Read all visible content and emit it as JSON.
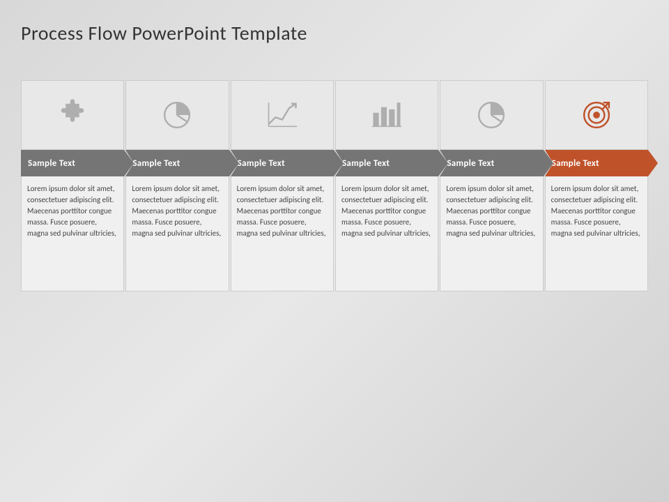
{
  "title": "Process Flow PowerPoint Template",
  "steps": [
    {
      "id": 1,
      "label": "Sample Text",
      "icon": "puzzle",
      "isLast": false,
      "isFirst": true,
      "body": "Lorem ipsum dolor sit amet, consectetuer adipiscing elit. Maecenas porttitor congue massa. Fusce posuere, magna sed pulvinar ultricies,"
    },
    {
      "id": 2,
      "label": "Sample Text",
      "icon": "pie",
      "isLast": false,
      "isFirst": false,
      "body": "Lorem ipsum dolor sit amet, consectetuer adipiscing elit. Maecenas porttitor congue massa. Fusce posuere, magna sed pulvinar ultricies,"
    },
    {
      "id": 3,
      "label": "Sample Text",
      "icon": "linechart",
      "isLast": false,
      "isFirst": false,
      "body": "Lorem ipsum dolor sit amet, consectetuer adipiscing elit. Maecenas porttitor congue massa. Fusce posuere, magna sed pulvinar ultricies,"
    },
    {
      "id": 4,
      "label": "Sample Text",
      "icon": "barchart",
      "isLast": false,
      "isFirst": false,
      "body": "Lorem ipsum dolor sit amet, consectetuer adipiscing elit. Maecenas porttitor congue massa. Fusce posuere, magna sed pulvinar ultricies,"
    },
    {
      "id": 5,
      "label": "Sample Text",
      "icon": "pie2",
      "isLast": false,
      "isFirst": false,
      "body": "Lorem ipsum dolor sit amet, consectetuer adipiscing elit. Maecenas porttitor congue massa. Fusce posuere, magna sed pulvinar ultricies,"
    },
    {
      "id": 6,
      "label": "Sample Text",
      "icon": "target",
      "isLast": true,
      "isFirst": false,
      "body": "Lorem ipsum dolor sit amet, consectetuer adipiscing elit. Maecenas porttitor congue massa. Fusce posuere, magna sed pulvinar ultricies,"
    }
  ]
}
